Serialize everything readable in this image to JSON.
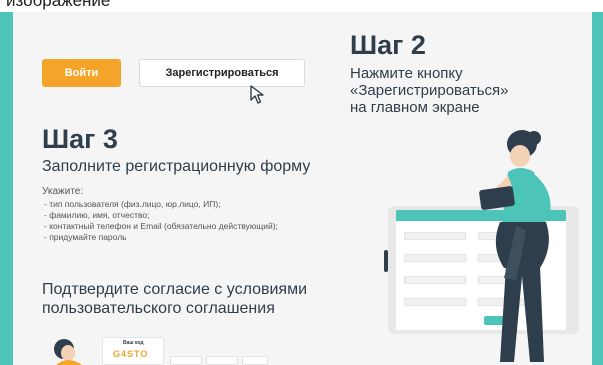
{
  "top_fragment": "изображение",
  "buttons": {
    "login": "Войти",
    "register": "Зарегистрироваться"
  },
  "step2": {
    "title": "Шаг 2",
    "description": "Нажмите кнопку\n«Зарегистрироваться»\nна главном экране"
  },
  "step3": {
    "title": "Шаг 3",
    "subtitle": "Заполните регистрационную форму",
    "specify_label": "Укажите:",
    "items": [
      "тип пользователя (физ.лицо, юр.лицо, ИП);",
      "фамилию, имя, отчество;",
      "контактный телефон и Email (обязательно действующий);",
      "придумайте пароль"
    ],
    "confirm": "Подтвердите согласие с условиями\nпользовательского соглашения"
  },
  "mini_card": {
    "label": "Ваш код",
    "code": "G4STO"
  },
  "colors": {
    "teal": "#4cc4b8",
    "orange": "#f4a428",
    "text_dark": "#2f3e4c"
  },
  "icons": [
    "mouse-pointer-icon",
    "woman-with-phone-illustration",
    "tablet-form-mockup",
    "small-woman-illustration"
  ]
}
